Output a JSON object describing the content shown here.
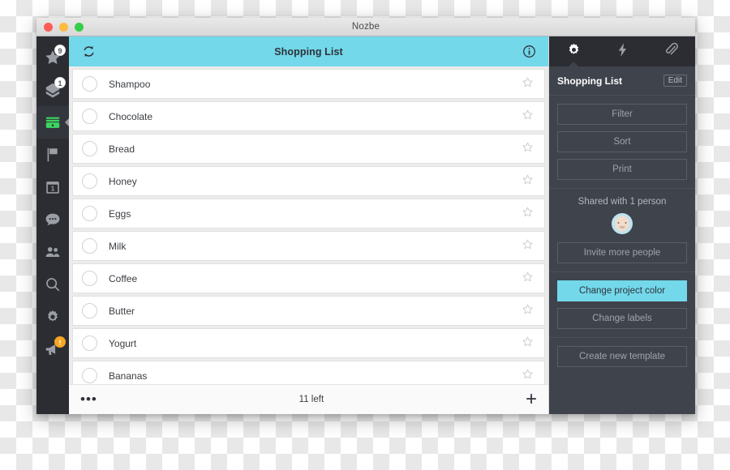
{
  "window": {
    "title": "Nozbe",
    "traffic_lights": [
      "close",
      "minimize",
      "maximize"
    ]
  },
  "sidebar": {
    "items": [
      {
        "name": "priority",
        "icon": "star-icon",
        "badge": "9",
        "badge_style": "plain",
        "active": false
      },
      {
        "name": "inbox",
        "icon": "inbox-icon",
        "badge": "1",
        "badge_style": "plain",
        "active": false
      },
      {
        "name": "projects",
        "icon": "projects-icon",
        "badge": "",
        "badge_style": "",
        "active": true
      },
      {
        "name": "labels",
        "icon": "flag-icon",
        "badge": "",
        "badge_style": "",
        "active": false
      },
      {
        "name": "calendar",
        "icon": "calendar-icon",
        "badge": "1",
        "badge_style": "inline",
        "active": false
      },
      {
        "name": "comments",
        "icon": "chat-icon",
        "badge": "",
        "badge_style": "",
        "active": false
      },
      {
        "name": "team",
        "icon": "people-icon",
        "badge": "",
        "badge_style": "",
        "active": false
      },
      {
        "name": "search",
        "icon": "search-icon",
        "badge": "",
        "badge_style": "",
        "active": false
      },
      {
        "name": "settings",
        "icon": "gear-icon",
        "badge": "",
        "badge_style": "",
        "active": false
      },
      {
        "name": "news",
        "icon": "megaphone-icon",
        "badge": "!",
        "badge_style": "alert",
        "active": false
      }
    ]
  },
  "list": {
    "header": {
      "title": "Shopping List",
      "refresh_icon": "sync-icon",
      "info_icon": "info-icon"
    },
    "tasks": [
      {
        "name": "Shampoo",
        "starred": false,
        "done": false
      },
      {
        "name": "Chocolate",
        "starred": false,
        "done": false
      },
      {
        "name": "Bread",
        "starred": false,
        "done": false
      },
      {
        "name": "Honey",
        "starred": false,
        "done": false
      },
      {
        "name": "Eggs",
        "starred": false,
        "done": false
      },
      {
        "name": "Milk",
        "starred": false,
        "done": false
      },
      {
        "name": "Coffee",
        "starred": false,
        "done": false
      },
      {
        "name": "Butter",
        "starred": false,
        "done": false
      },
      {
        "name": "Yogurt",
        "starred": false,
        "done": false
      },
      {
        "name": "Bananas",
        "starred": false,
        "done": false
      }
    ],
    "footer": {
      "more_label": "•••",
      "count_label": "11 left",
      "add_label": "+"
    }
  },
  "detail": {
    "tabs": [
      {
        "name": "project-settings",
        "icon": "gear-icon",
        "active": true
      },
      {
        "name": "activity",
        "icon": "bolt-icon",
        "active": false
      },
      {
        "name": "attachments",
        "icon": "paperclip-icon",
        "active": false
      }
    ],
    "title": "Shopping List",
    "edit_label": "Edit",
    "actions": [
      {
        "label": "Filter",
        "highlight": false
      },
      {
        "label": "Sort",
        "highlight": false
      },
      {
        "label": "Print",
        "highlight": false
      }
    ],
    "sharing": {
      "label": "Shared with 1 person",
      "avatar_name": "shared-user-avatar",
      "invite_label": "Invite more people"
    },
    "project_actions": [
      {
        "label": "Change project color",
        "highlight": true
      },
      {
        "label": "Change labels",
        "highlight": false
      }
    ],
    "template_actions": [
      {
        "label": "Create new template",
        "highlight": false
      }
    ]
  },
  "colors": {
    "accent_cyan": "#72d8ea",
    "rail_dark": "#2b2d33",
    "panel_dark": "#3f434c",
    "badge_alert": "#f5a623"
  }
}
